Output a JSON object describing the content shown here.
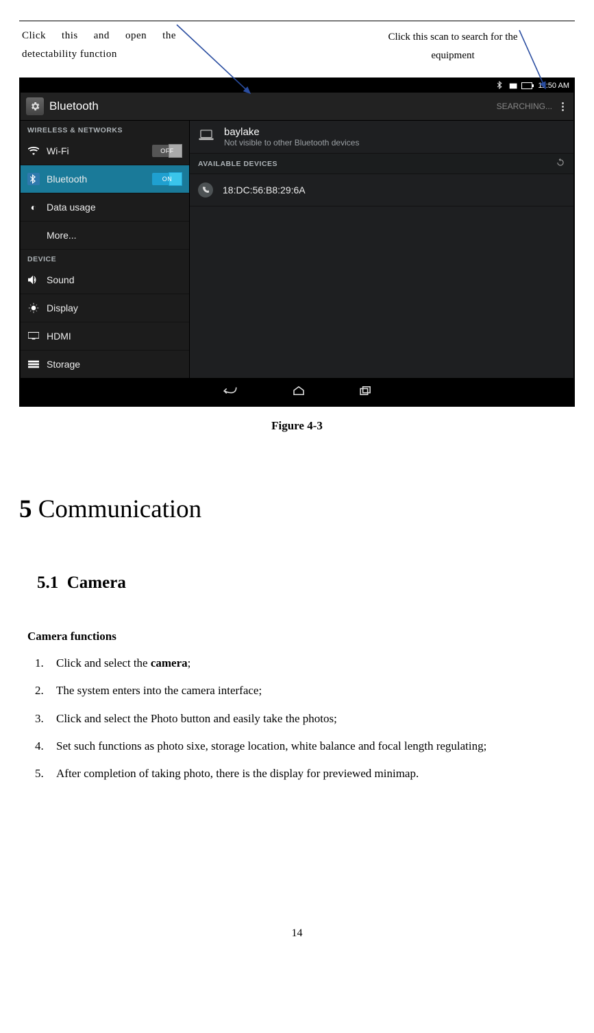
{
  "callouts": {
    "left_text": "Click this and open the detectability function",
    "right_text": "Click this scan to search for the equipment"
  },
  "screenshot": {
    "status_time": "11:50 AM",
    "header_title": "Bluetooth",
    "header_searching": "SEARCHING...",
    "sidebar": {
      "section_wireless": "WIRELESS & NETWORKS",
      "wifi": "Wi-Fi",
      "wifi_toggle": "OFF",
      "bluetooth": "Bluetooth",
      "bluetooth_toggle": "ON",
      "datausage": "Data usage",
      "more": "More...",
      "section_device": "DEVICE",
      "sound": "Sound",
      "display": "Display",
      "hdmi": "HDMI",
      "storage": "Storage"
    },
    "main": {
      "device_name": "baylake",
      "device_sub": "Not visible to other Bluetooth devices",
      "available_label": "AVAILABLE DEVICES",
      "avail_item": "18:DC:56:B8:29:6A"
    }
  },
  "figure_caption": "Figure 4-3",
  "chapter_num": "5",
  "chapter_title": "Communication",
  "section_num": "5.1",
  "section_title": "Camera",
  "subhead": "Camera functions",
  "steps": {
    "s1a": "Click and select the ",
    "s1b": "camera",
    "s1c": ";",
    "s2": "The system enters into the camera interface;",
    "s3": "Click and select the Photo button and easily take the photos;",
    "s4": "Set such functions as photo sixe, storage location, white balance and focal length regulating;",
    "s5": "After completion of taking photo, there is the display for previewed minimap."
  },
  "pagenum": "14"
}
